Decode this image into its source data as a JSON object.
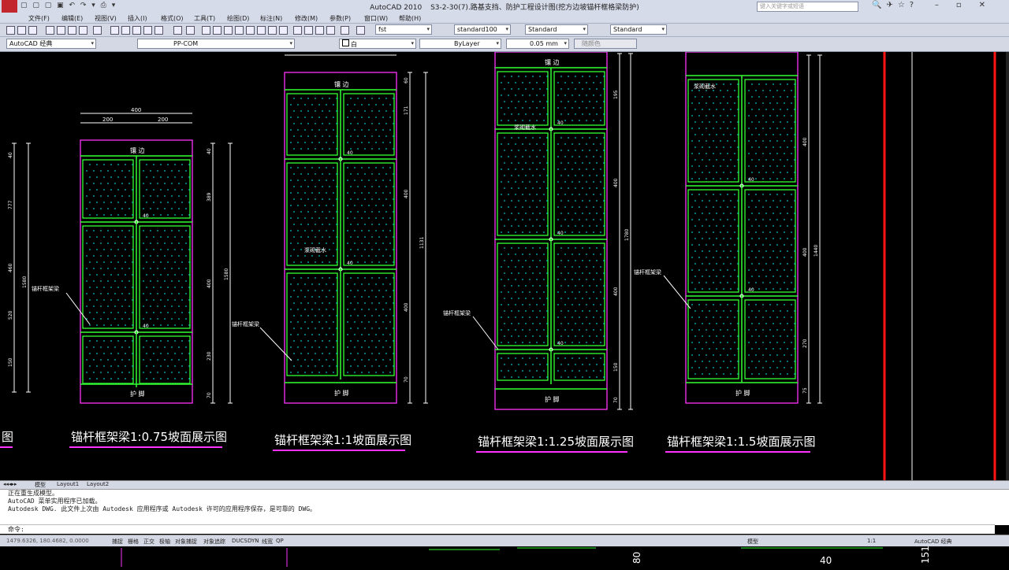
{
  "window": {
    "app_title": "AutoCAD 2010",
    "file_title": "S3-2-30(7).路基支挡、防护工程设计图(挖方边坡锚杆框格梁防护)",
    "search_placeholder": "键入关键字或短语"
  },
  "menu": [
    "文件(F)",
    "编辑(E)",
    "视图(V)",
    "插入(I)",
    "格式(O)",
    "工具(T)",
    "绘图(D)",
    "标注(N)",
    "修改(M)",
    "参数(P)",
    "窗口(W)",
    "帮助(H)"
  ],
  "toolbar": {
    "text_style": "fst",
    "dim_style": "standard100",
    "table_style": "Standard",
    "mleader_style": "Standard",
    "workspace": "AutoCAD 经典",
    "layer": "PP-COM",
    "color": "白",
    "linetype": "ByLayer",
    "lineweight": "0.05 mm",
    "plotstyle": "随颜色"
  },
  "drawing": {
    "captions": [
      "锚杆框架梁1:0.75坡面展示图",
      "锚杆框架梁1:1坡面展示图",
      "锚杆框架梁1:1.25坡面展示图",
      "锚杆框架梁1:1.5坡面展示图"
    ],
    "partial_caption": "图",
    "top_label": "镶 边",
    "bottom_label": "护 脚",
    "leader_labels": [
      "锚杆框架梁",
      "锚杆框架梁",
      "锚杆框架梁",
      "锚杆框架梁"
    ],
    "inner_labels": [
      "浆砌截水",
      "浆砌截水",
      "浆砌截水"
    ],
    "dim_top": [
      "400",
      "200",
      "200"
    ],
    "dims_panel1_left": [
      "40",
      "777",
      "460",
      "520",
      "150"
    ],
    "dims_panel1_total": "1580",
    "dims_panel1_right": [
      "40",
      "389",
      "400",
      "230",
      "70"
    ],
    "dims_panel1_total_right": "1580",
    "dims_panel2": [
      "60",
      "171",
      "400",
      "400",
      "400",
      "70"
    ],
    "dims_panel2_total": "1131",
    "dims_panel3": [
      "195",
      "400",
      "400",
      "150",
      "70"
    ],
    "dims_panel3_total": "1780",
    "dims_panel4": [
      "400",
      "400",
      "270",
      "75"
    ],
    "dims_panel4_total": "1440",
    "small_dims": [
      "40",
      "40",
      "40",
      "40"
    ]
  },
  "tabs": [
    "模型",
    "Layout1",
    "Layout2"
  ],
  "command": {
    "history": [
      "正在重生成模型。",
      "AutoCAD 菜单实用程序已加载。",
      "Autodesk DWG.  此文件上次由 Autodesk 应用程序或 Autodesk 许可的应用程序保存，是可靠的 DWG。"
    ],
    "prompt": "命令:"
  },
  "status": {
    "coords": "1479.6326, 180.4682, 0.0000",
    "toggles": [
      "捕捉",
      "栅格",
      "正交",
      "极轴",
      "对象捕捉",
      "对象追踪",
      "DUCS",
      "DYN",
      "线宽",
      "QP"
    ],
    "right": [
      "模型",
      "1:1",
      "AutoCAD 经典"
    ]
  },
  "taskbar": {
    "labels": [
      "80",
      "40",
      "151"
    ]
  },
  "colors": {
    "frame": "#32ff32",
    "border": "#ff32ff",
    "fill": "#00c8c8",
    "dim": "#ffffff",
    "red": "#ff1414",
    "leader": "#ffffff"
  }
}
